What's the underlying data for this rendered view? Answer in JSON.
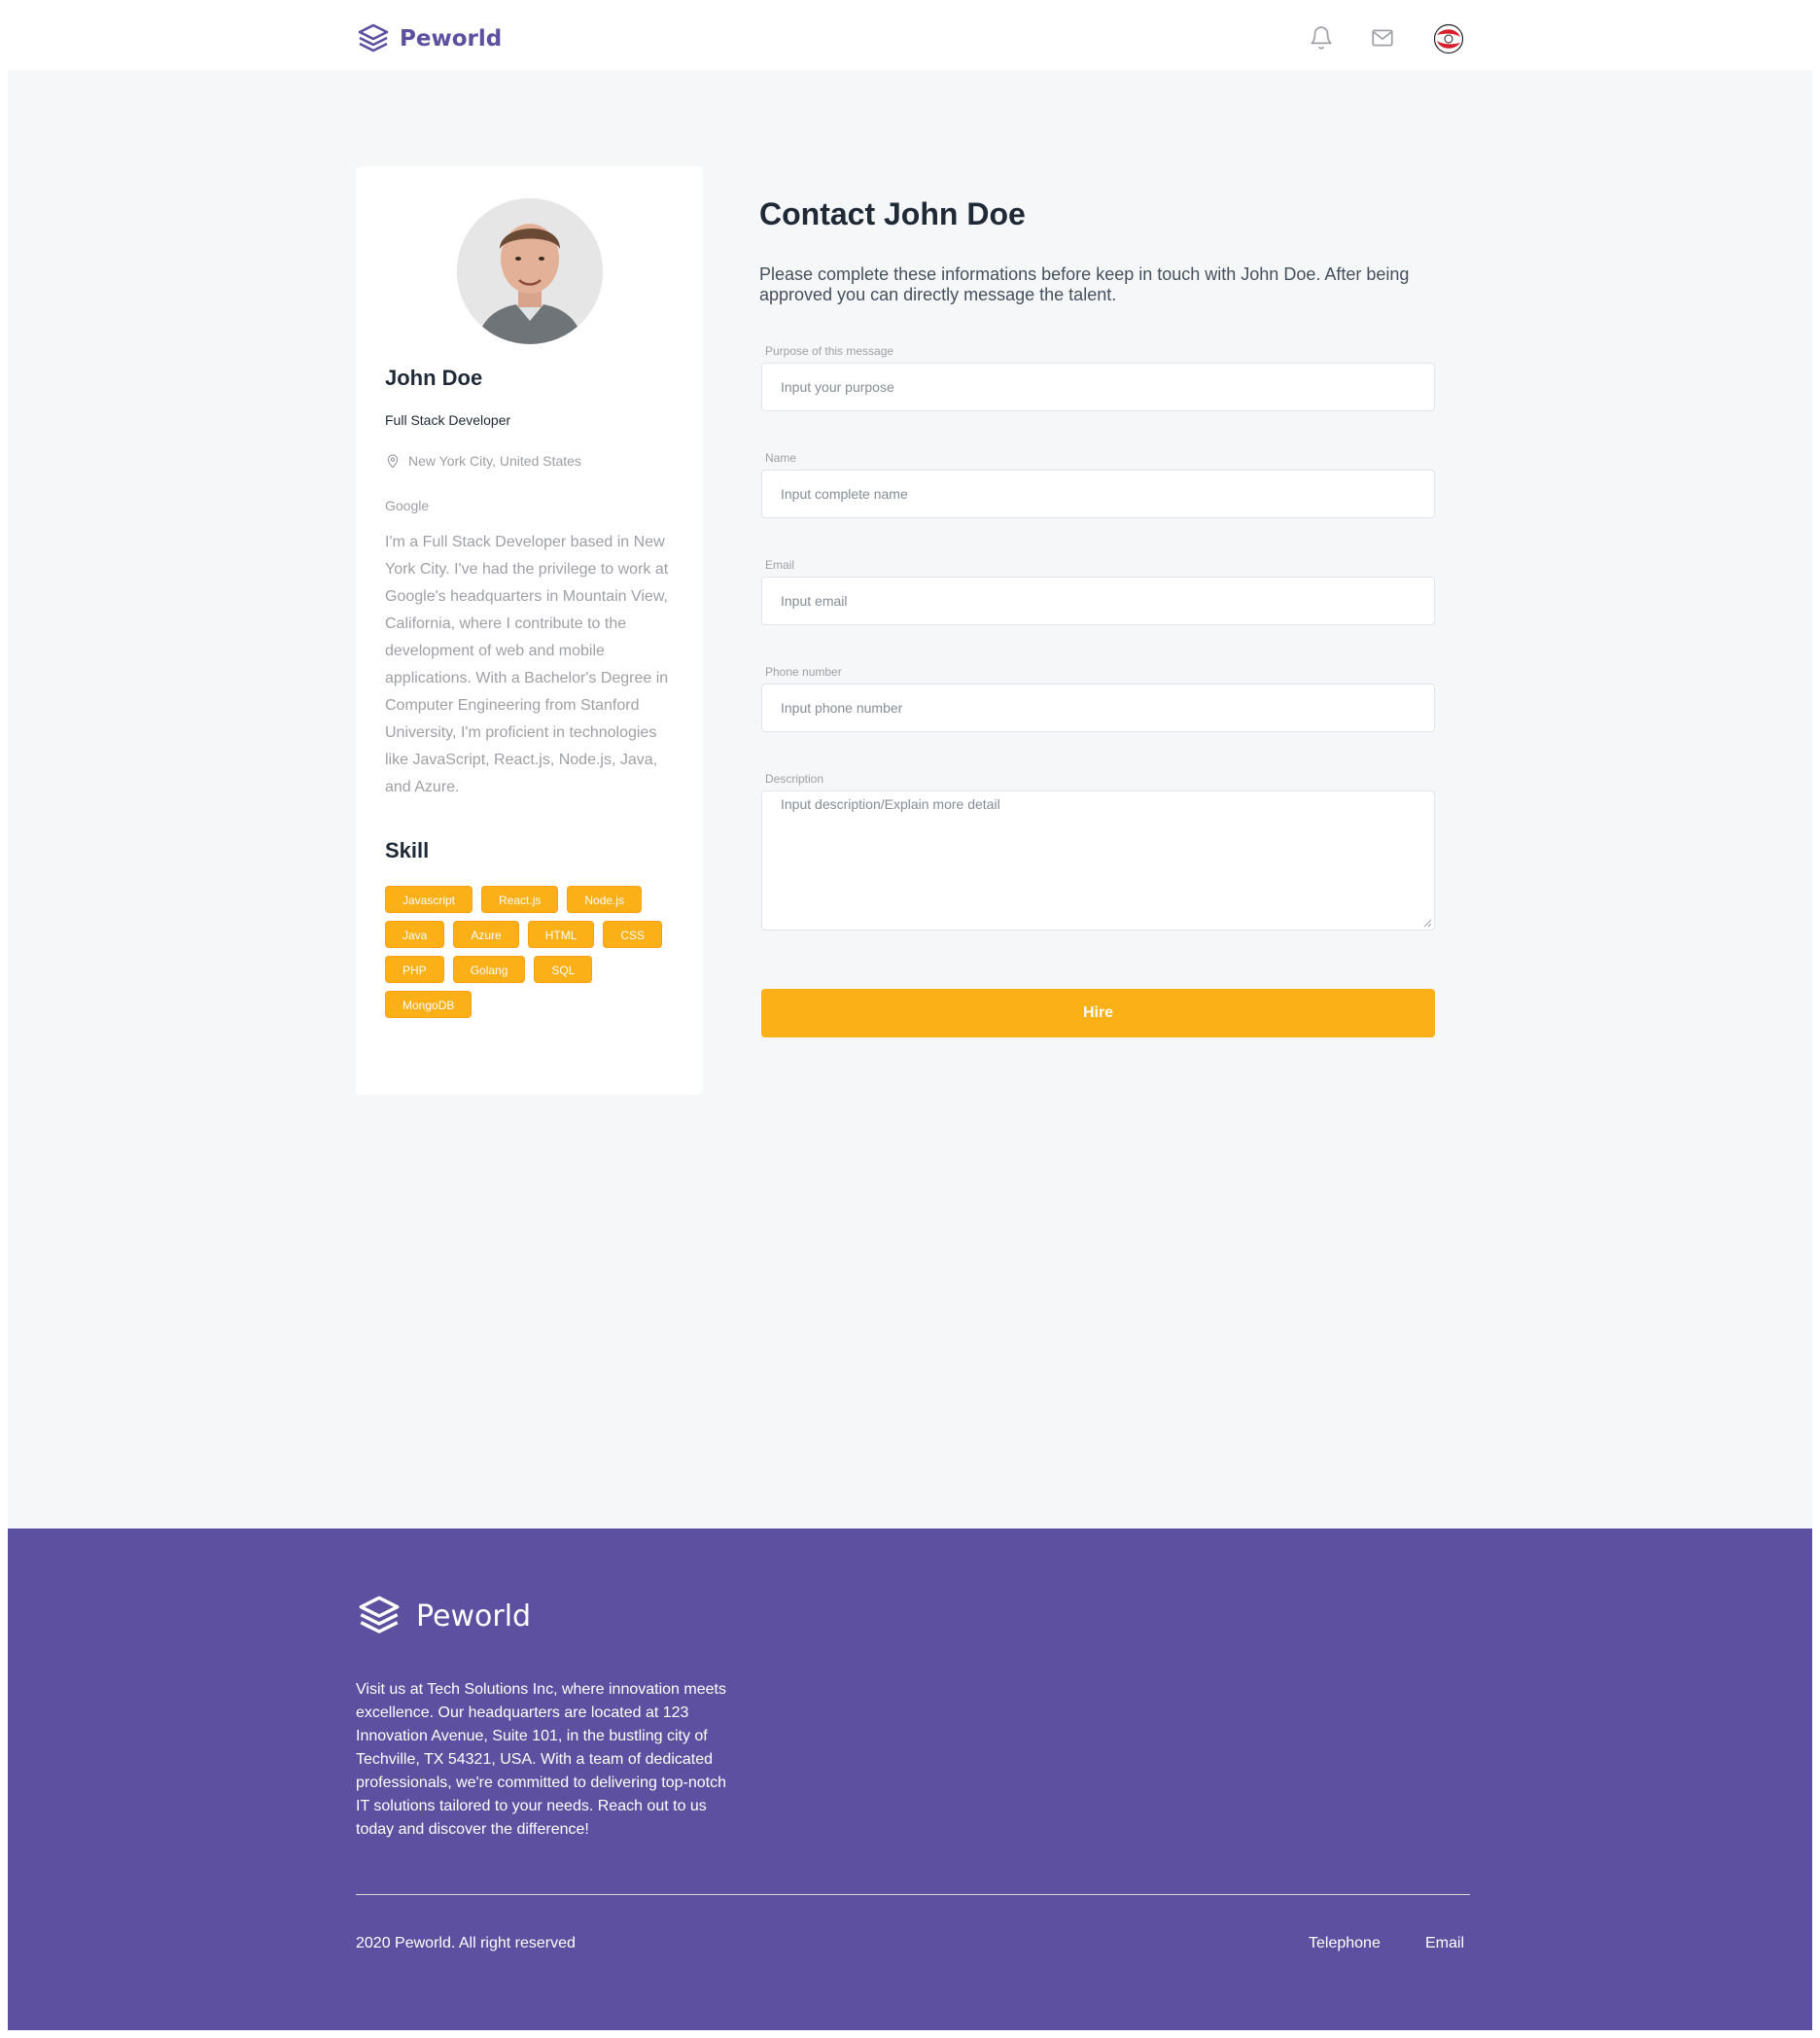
{
  "header": {
    "brand": "Peworld",
    "icons": [
      "bell-icon",
      "mail-icon",
      "user-avatar"
    ]
  },
  "profile": {
    "name": "John Doe",
    "title": "Full Stack Developer",
    "location": "New York City, United States",
    "company": "Google",
    "bio": "I'm a Full Stack Developer based in New York City. I've had the privilege to work at Google's headquarters in Mountain View, California, where I contribute to the development of web and mobile applications. With a Bachelor's Degree in Computer Engineering from Stanford University, I'm proficient in technologies like JavaScript, React.js, Node.js, Java, and Azure.",
    "skill_title": "Skill",
    "skills": [
      "Javascript",
      "React.js",
      "Node.js",
      "Java",
      "Azure",
      "HTML",
      "CSS",
      "PHP",
      "Golang",
      "SQL",
      "MongoDB"
    ]
  },
  "contact": {
    "title": "Contact John Doe",
    "description": "Please complete these informations before keep in touch with John Doe. After being approved you can directly message the talent.",
    "fields": {
      "purpose": {
        "label": "Purpose of this message",
        "placeholder": "Input your purpose",
        "value": ""
      },
      "name": {
        "label": "Name",
        "placeholder": "Input complete name",
        "value": ""
      },
      "email": {
        "label": "Email",
        "placeholder": "Input email",
        "value": ""
      },
      "phone": {
        "label": "Phone number",
        "placeholder": "Input phone number",
        "value": ""
      },
      "description": {
        "label": "Description",
        "placeholder": "Input description/Explain more detail",
        "value": ""
      }
    },
    "submit_label": "Hire"
  },
  "footer": {
    "brand": "Peworld",
    "about": "Visit us at Tech Solutions Inc, where innovation meets excellence. Our headquarters are located at 123 Innovation Avenue, Suite 101, in the bustling city of Techville, TX 54321, USA. With a team of dedicated professionals, we're committed to delivering top-notch IT solutions tailored to your needs. Reach out to us today and discover the difference!",
    "copyright": "2020 Peworld. All right reserved",
    "links": {
      "telephone": "Telephone",
      "email": "Email"
    }
  },
  "colors": {
    "brand_purple": "#5E50A1",
    "accent_yellow": "#FBB017",
    "background": "#F6F7F8",
    "text_dark": "#1F2A36",
    "text_muted": "#9EA0A5"
  }
}
